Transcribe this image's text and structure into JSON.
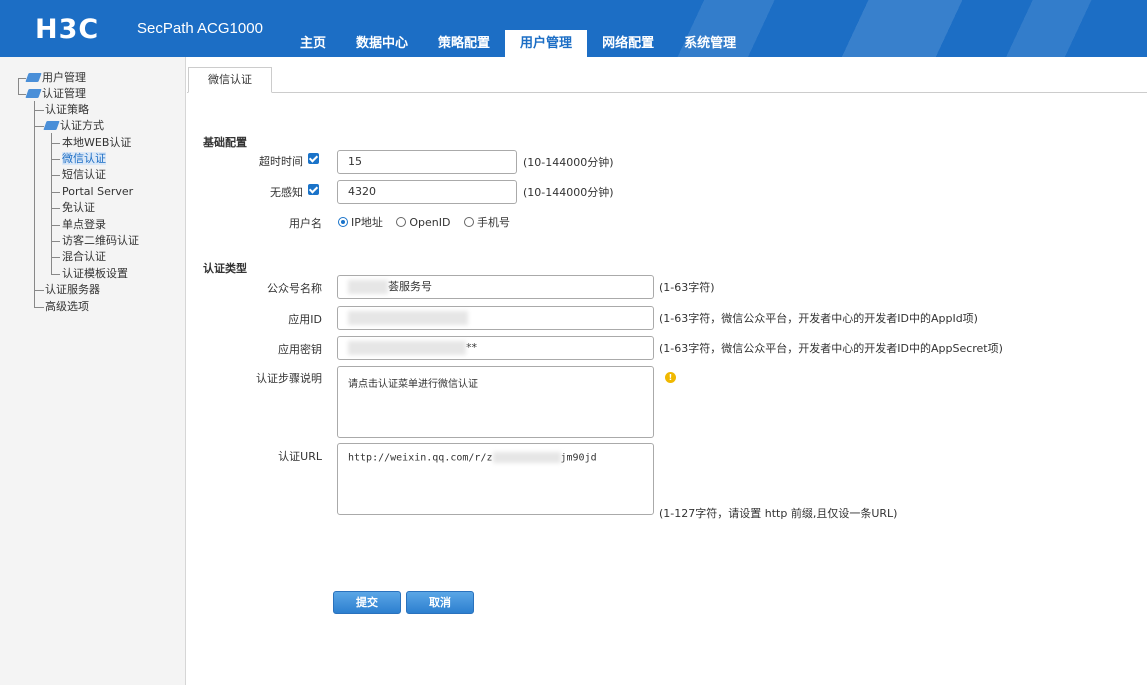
{
  "header": {
    "logo": "H3C",
    "product": "SecPath ACG1000",
    "tabs": [
      {
        "label": "主页"
      },
      {
        "label": "数据中心"
      },
      {
        "label": "策略配置"
      },
      {
        "label": "用户管理"
      },
      {
        "label": "网络配置"
      },
      {
        "label": "系统管理"
      }
    ],
    "active_tab": "用户管理"
  },
  "sidebar": {
    "items": [
      {
        "label": "用户管理"
      },
      {
        "label": "认证管理"
      },
      {
        "label": "认证策略"
      },
      {
        "label": "认证方式"
      },
      {
        "label": "本地WEB认证"
      },
      {
        "label": "微信认证"
      },
      {
        "label": "短信认证"
      },
      {
        "label": "Portal Server"
      },
      {
        "label": "免认证"
      },
      {
        "label": "单点登录"
      },
      {
        "label": "访客二维码认证"
      },
      {
        "label": "混合认证"
      },
      {
        "label": "认证模板设置"
      },
      {
        "label": "认证服务器"
      },
      {
        "label": "高级选项"
      }
    ]
  },
  "page_tab": "微信认证",
  "basic": {
    "title": "基础配置",
    "timeout_label": "超时时间",
    "timeout_value": "15",
    "timeout_hint": "(10-144000分钟)",
    "insensitive_label": "无感知",
    "insensitive_value": "4320",
    "insensitive_hint": "(10-144000分钟)",
    "username_label": "用户名",
    "username_options": [
      "IP地址",
      "OpenID",
      "手机号"
    ],
    "username_selected": "IP地址"
  },
  "auth": {
    "title": "认证类型",
    "account_label": "公众号名称",
    "account_value_suffix": "荟服务号",
    "account_hint": "(1-63字符)",
    "appid_label": "应用ID",
    "appid_hint": "(1-63字符，微信公众平台，开发者中心的开发者ID中的AppId项)",
    "secret_label": "应用密钥",
    "secret_value_suffix": "**",
    "secret_hint": "(1-63字符，微信公众平台，开发者中心的开发者ID中的AppSecret项)",
    "steps_label": "认证步骤说明",
    "steps_value": "请点击认证菜单进行微信认证",
    "url_label": "认证URL",
    "url_prefix": "http://weixin.qq.com/r/z",
    "url_suffix": "jm90jd",
    "url_hint": "(1-127字符，请设置 http 前缀,且仅设一条URL)"
  },
  "buttons": {
    "submit": "提交",
    "cancel": "取消"
  },
  "colors": {
    "header_bg": "#1c6ec5",
    "accent": "#1a73c9"
  }
}
